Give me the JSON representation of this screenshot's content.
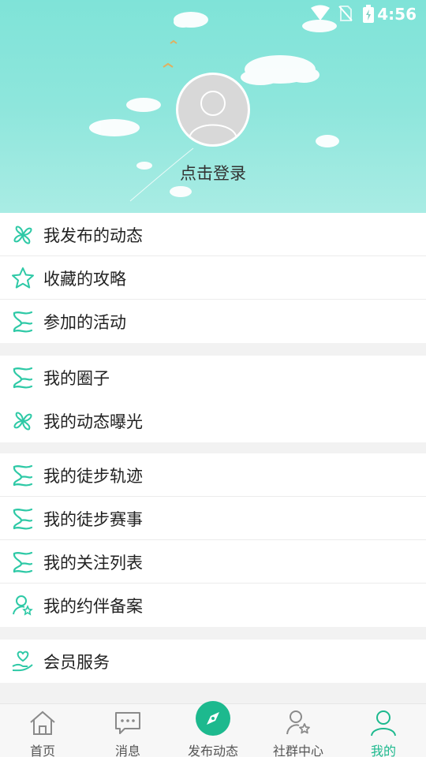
{
  "status_bar": {
    "time": "4:56",
    "icons": [
      "wifi-icon",
      "no-sim-icon",
      "battery-charging-icon"
    ]
  },
  "profile": {
    "login_label": "点击登录"
  },
  "menu_groups": [
    {
      "items": [
        {
          "label": "我发布的动态",
          "icon": "pinwheel-icon"
        },
        {
          "label": "收藏的攻略",
          "icon": "star-icon"
        },
        {
          "label": "参加的活动",
          "icon": "flag-icon"
        }
      ]
    },
    {
      "items": [
        {
          "label": "我的圈子",
          "icon": "flag-icon"
        },
        {
          "label": "我的动态曝光",
          "icon": "pinwheel-icon"
        }
      ]
    },
    {
      "items": [
        {
          "label": "我的徒步轨迹",
          "icon": "flag-icon"
        },
        {
          "label": "我的徒步赛事",
          "icon": "flag-icon"
        },
        {
          "label": "我的关注列表",
          "icon": "flag-icon"
        },
        {
          "label": "我的约伴备案",
          "icon": "user-star-icon"
        }
      ]
    },
    {
      "items": [
        {
          "label": "会员服务",
          "icon": "heart-hand-icon"
        }
      ]
    }
  ],
  "bottom_nav": [
    {
      "label": "首页",
      "icon": "home-icon",
      "active": false
    },
    {
      "label": "消息",
      "icon": "message-icon",
      "active": false
    },
    {
      "label": "发布动态",
      "icon": "compass-icon",
      "active": false
    },
    {
      "label": "社群中心",
      "icon": "community-icon",
      "active": false
    },
    {
      "label": "我的",
      "icon": "user-icon",
      "active": true
    }
  ],
  "colors": {
    "accent": "#1db98e",
    "header_bg": "#8ee6dc",
    "icon_teal": "#2ec9a6"
  }
}
